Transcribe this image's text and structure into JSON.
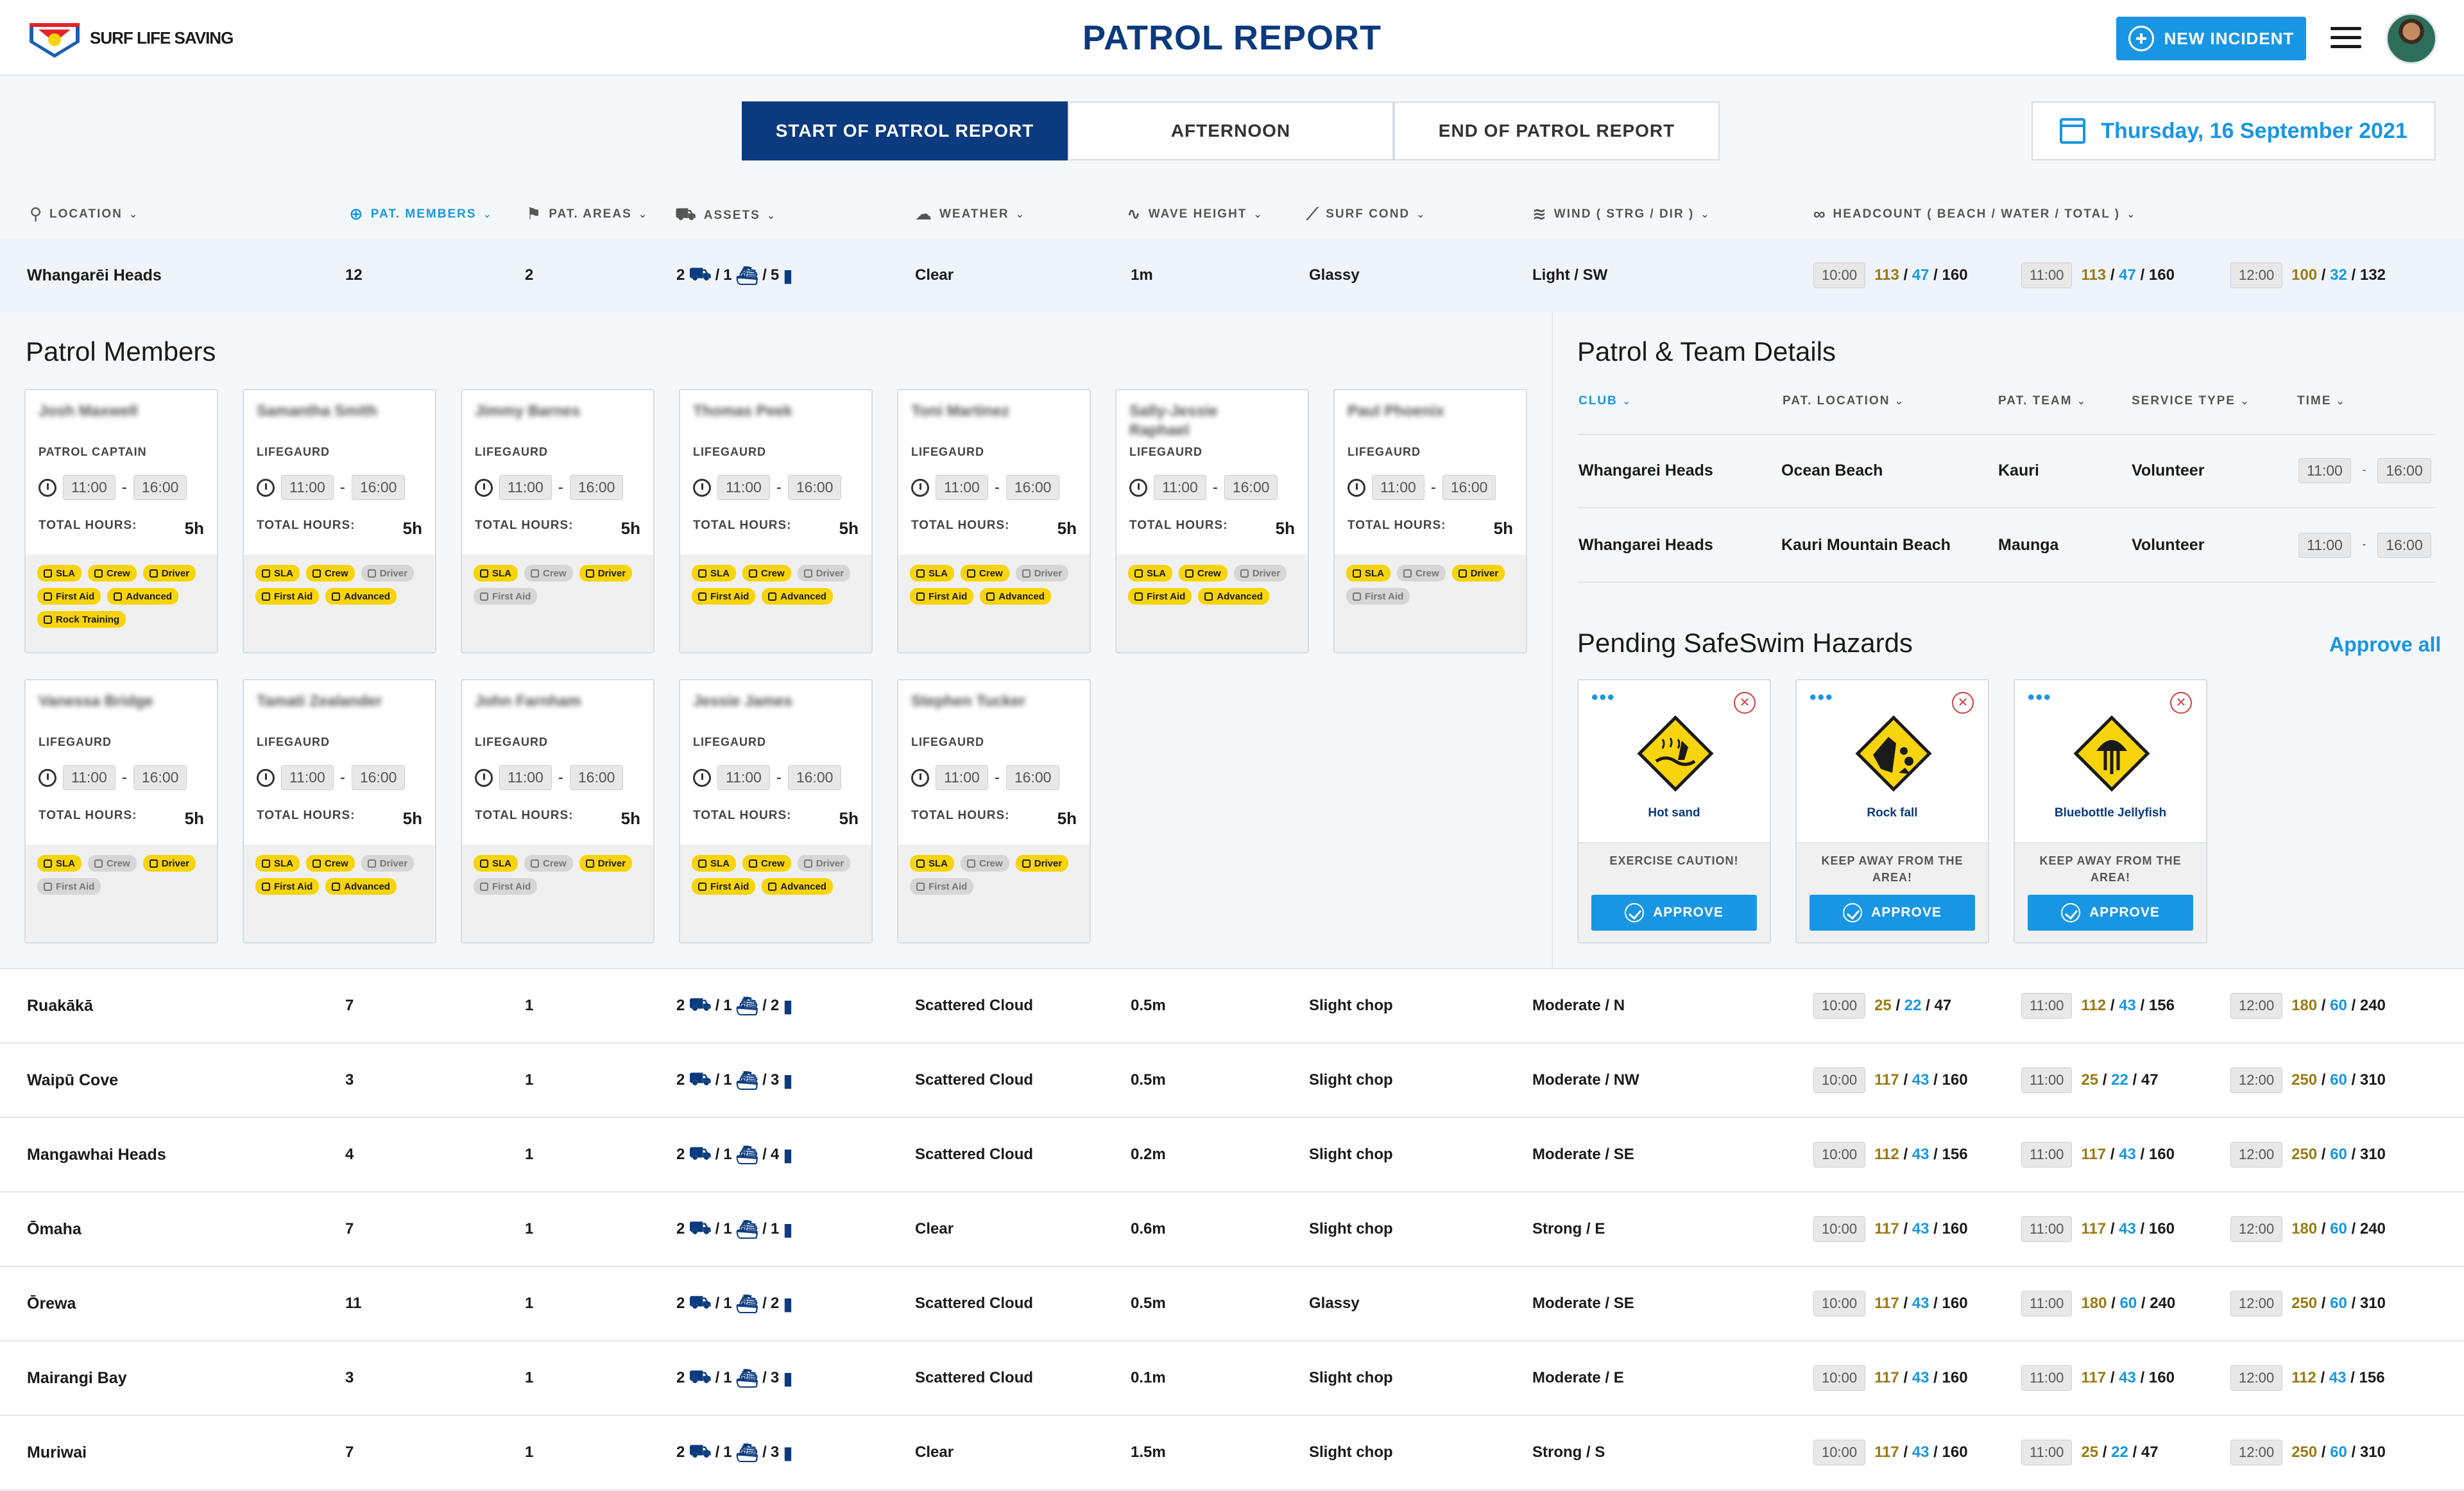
{
  "header": {
    "logo_text": "SURF LIFE SAVING",
    "title": "PATROL REPORT",
    "new_incident_label": "NEW INCIDENT"
  },
  "tabs": [
    {
      "label": "START OF PATROL REPORT",
      "active": true
    },
    {
      "label": "AFTERNOON",
      "active": false
    },
    {
      "label": "END OF PATROL REPORT",
      "active": false
    }
  ],
  "date_label": "Thursday, 16 September 2021",
  "columns": {
    "location": "LOCATION",
    "members": "PAT. MEMBERS",
    "areas": "PAT. AREAS",
    "assets": "ASSETS",
    "weather": "WEATHER",
    "wave": "WAVE HEIGHT",
    "surf": "SURF COND",
    "wind": "WIND ( STRG / DIR )",
    "headcount": "HEADCOUNT ( BEACH / WATER / TOTAL )"
  },
  "rows": [
    {
      "location": "Whangarēi Heads",
      "members": "12",
      "areas": "2",
      "a1": "2",
      "a2": "1",
      "a3": "5",
      "weather": "Clear",
      "wave": "1m",
      "surf": "Glassy",
      "wind": "Light / SW",
      "hc": [
        {
          "time": "10:00",
          "b": "113",
          "w": "47",
          "t": "160"
        },
        {
          "time": "11:00",
          "b": "113",
          "w": "47",
          "t": "160"
        },
        {
          "time": "12:00",
          "b": "100",
          "w": "32",
          "t": "132"
        }
      ]
    },
    {
      "location": "Ruakākā",
      "members": "7",
      "areas": "1",
      "a1": "2",
      "a2": "1",
      "a3": "2",
      "weather": "Scattered Cloud",
      "wave": "0.5m",
      "surf": "Slight chop",
      "wind": "Moderate / N",
      "hc": [
        {
          "time": "10:00",
          "b": "25",
          "w": "22",
          "t": "47"
        },
        {
          "time": "11:00",
          "b": "112",
          "w": "43",
          "t": "156"
        },
        {
          "time": "12:00",
          "b": "180",
          "w": "60",
          "t": "240"
        }
      ]
    },
    {
      "location": "Waipū Cove",
      "members": "3",
      "areas": "1",
      "a1": "2",
      "a2": "1",
      "a3": "3",
      "weather": "Scattered Cloud",
      "wave": "0.5m",
      "surf": "Slight chop",
      "wind": "Moderate / NW",
      "hc": [
        {
          "time": "10:00",
          "b": "117",
          "w": "43",
          "t": "160"
        },
        {
          "time": "11:00",
          "b": "25",
          "w": "22",
          "t": "47"
        },
        {
          "time": "12:00",
          "b": "250",
          "w": "60",
          "t": "310"
        }
      ]
    },
    {
      "location": "Mangawhai Heads",
      "members": "4",
      "areas": "1",
      "a1": "2",
      "a2": "1",
      "a3": "4",
      "weather": "Scattered Cloud",
      "wave": "0.2m",
      "surf": "Slight chop",
      "wind": "Moderate / SE",
      "hc": [
        {
          "time": "10:00",
          "b": "112",
          "w": "43",
          "t": "156"
        },
        {
          "time": "11:00",
          "b": "117",
          "w": "43",
          "t": "160"
        },
        {
          "time": "12:00",
          "b": "250",
          "w": "60",
          "t": "310"
        }
      ]
    },
    {
      "location": "Ōmaha",
      "members": "7",
      "areas": "1",
      "a1": "2",
      "a2": "1",
      "a3": "1",
      "weather": "Clear",
      "wave": "0.6m",
      "surf": "Slight chop",
      "wind": "Strong / E",
      "hc": [
        {
          "time": "10:00",
          "b": "117",
          "w": "43",
          "t": "160"
        },
        {
          "time": "11:00",
          "b": "117",
          "w": "43",
          "t": "160"
        },
        {
          "time": "12:00",
          "b": "180",
          "w": "60",
          "t": "240"
        }
      ]
    },
    {
      "location": "Ōrewa",
      "members": "11",
      "areas": "1",
      "a1": "2",
      "a2": "1",
      "a3": "2",
      "weather": "Scattered Cloud",
      "wave": "0.5m",
      "surf": "Glassy",
      "wind": "Moderate / SE",
      "hc": [
        {
          "time": "10:00",
          "b": "117",
          "w": "43",
          "t": "160"
        },
        {
          "time": "11:00",
          "b": "180",
          "w": "60",
          "t": "240"
        },
        {
          "time": "12:00",
          "b": "250",
          "w": "60",
          "t": "310"
        }
      ]
    },
    {
      "location": "Mairangi Bay",
      "members": "3",
      "areas": "1",
      "a1": "2",
      "a2": "1",
      "a3": "3",
      "weather": "Scattered Cloud",
      "wave": "0.1m",
      "surf": "Slight chop",
      "wind": "Moderate / E",
      "hc": [
        {
          "time": "10:00",
          "b": "117",
          "w": "43",
          "t": "160"
        },
        {
          "time": "11:00",
          "b": "117",
          "w": "43",
          "t": "160"
        },
        {
          "time": "12:00",
          "b": "112",
          "w": "43",
          "t": "156"
        }
      ]
    },
    {
      "location": "Muriwai",
      "members": "7",
      "areas": "1",
      "a1": "2",
      "a2": "1",
      "a3": "3",
      "weather": "Clear",
      "wave": "1.5m",
      "surf": "Slight chop",
      "wind": "Strong / S",
      "hc": [
        {
          "time": "10:00",
          "b": "117",
          "w": "43",
          "t": "160"
        },
        {
          "time": "11:00",
          "b": "25",
          "w": "22",
          "t": "47"
        },
        {
          "time": "12:00",
          "b": "250",
          "w": "60",
          "t": "310"
        }
      ]
    }
  ],
  "patrol_members": {
    "title": "Patrol Members",
    "total_hours_label": "TOTAL HOURS:",
    "members": [
      {
        "name": "Josh Maxwell",
        "role": "PATROL CAPTAIN",
        "start": "11:00",
        "end": "16:00",
        "hours": "5h"
      },
      {
        "name": "Samantha Smith",
        "role": "LIFEGAURD",
        "start": "11:00",
        "end": "16:00",
        "hours": "5h"
      },
      {
        "name": "Jimmy Barnes",
        "role": "LIFEGAURD",
        "start": "11:00",
        "end": "16:00",
        "hours": "5h"
      },
      {
        "name": "Thomas Peek",
        "role": "LIFEGAURD",
        "start": "11:00",
        "end": "16:00",
        "hours": "5h"
      },
      {
        "name": "Toni Martinez",
        "role": "LIFEGAURD",
        "start": "11:00",
        "end": "16:00",
        "hours": "5h"
      },
      {
        "name": "Sally-Jessie Raphael",
        "role": "LIFEGAURD",
        "start": "11:00",
        "end": "16:00",
        "hours": "5h"
      },
      {
        "name": "Paul Phoenix",
        "role": "LIFEGAURD",
        "start": "11:00",
        "end": "16:00",
        "hours": "5h"
      },
      {
        "name": "Vanessa Bridge",
        "role": "LIFEGAURD",
        "start": "11:00",
        "end": "16:00",
        "hours": "5h"
      },
      {
        "name": "Tamati Zealander",
        "role": "LIFEGAURD",
        "start": "11:00",
        "end": "16:00",
        "hours": "5h"
      },
      {
        "name": "John Farnham",
        "role": "LIFEGAURD",
        "start": "11:00",
        "end": "16:00",
        "hours": "5h"
      },
      {
        "name": "Jessie James",
        "role": "LIFEGAURD",
        "start": "11:00",
        "end": "16:00",
        "hours": "5h"
      },
      {
        "name": "Stephen Tucker",
        "role": "LIFEGAURD",
        "start": "11:00",
        "end": "16:00",
        "hours": "5h"
      }
    ],
    "tag_labels": {
      "sla": "SLA",
      "crew": "Crew",
      "driver": "Driver",
      "first_aid": "First Aid",
      "advanced": "Advanced",
      "rock": "Rock Training"
    }
  },
  "team_details": {
    "title": "Patrol & Team Details",
    "headers": {
      "club": "CLUB",
      "location": "PAT. LOCATION",
      "team": "PAT. TEAM",
      "service": "SERVICE TYPE",
      "time": "TIME"
    },
    "rows": [
      {
        "club": "Whangarei Heads",
        "location": "Ocean Beach",
        "team": "Kauri",
        "service": "Volunteer",
        "start": "11:00",
        "end": "16:00"
      },
      {
        "club": "Whangarei Heads",
        "location": "Kauri Mountain Beach",
        "team": "Maunga",
        "service": "Volunteer",
        "start": "11:00",
        "end": "16:00"
      }
    ]
  },
  "hazards": {
    "title": "Pending SafeSwim Hazards",
    "approve_all": "Approve all",
    "approve_label": "APPROVE",
    "items": [
      {
        "label": "Hot sand",
        "warning": "EXERCISE CAUTION!"
      },
      {
        "label": "Rock fall",
        "warning": "KEEP AWAY FROM THE AREA!"
      },
      {
        "label": "Bluebottle Jellyfish",
        "warning": "KEEP AWAY FROM THE AREA!"
      }
    ]
  },
  "colors": {
    "primary": "#0b3a7e",
    "accent": "#1996e3",
    "beach": "#9a7b15",
    "tag_yellow": "#f7d40b"
  }
}
